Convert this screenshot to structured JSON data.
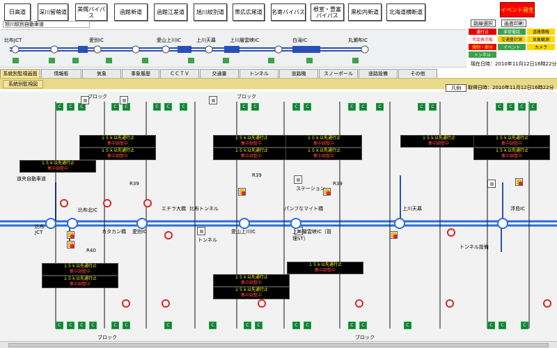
{
  "roads": [
    "日高道",
    "深川留萌道",
    "美幌バイパス",
    "函館新道",
    "函館江差道",
    "旭川紋別道",
    "帯広広尾道",
    "名寄バイパス",
    "根室・豊富バイパス",
    "黒松内新道",
    "北海道横断道"
  ],
  "event_button": "イベント発生",
  "route_label": "旭川紋別自動車道",
  "controls": {
    "route_select": "路線選択",
    "print": "画面印刷"
  },
  "legend": [
    {
      "label": "通行止",
      "bg": "#e60000",
      "fg": "#ffffff"
    },
    {
      "label": "非常電話",
      "bg": "#3aa24a",
      "fg": "#ffffff"
    },
    {
      "label": "道路情報",
      "bg": "#ffd800",
      "fg": "#000000"
    },
    {
      "label": "可変表示板",
      "bg": "#ffffff",
      "fg": "#e00000"
    },
    {
      "label": "交通量計測",
      "bg": "#ffd800",
      "fg": "#000000"
    },
    {
      "label": "気象観測",
      "bg": "#ffd800",
      "fg": "#000000"
    },
    {
      "label": "規制・部分",
      "bg": "#e60000",
      "fg": "#ffff00"
    },
    {
      "label": "イベント",
      "bg": "#3aa24a",
      "fg": "#ffffff"
    },
    {
      "label": "カメラ",
      "bg": "#ffd800",
      "fg": "#000000"
    },
    {
      "label": "トンネル",
      "bg": "#3aa24a",
      "fg": "#ffffff"
    },
    {
      "label": "",
      "bg": "#ffffff",
      "fg": "#000000"
    },
    {
      "label": "",
      "bg": "#ffffff",
      "fg": "#000000"
    }
  ],
  "current_time": "現在日時：2010年11月12日16時22分",
  "tabs": [
    "系統別監視画面",
    "情報板",
    "気象",
    "事象履歴",
    "ＣＣＴＶ",
    "交通量",
    "トンネル",
    "道路機",
    "スノーポール",
    "道路設備",
    "その他"
  ],
  "subtab": "系統別監視図",
  "hanrei": "凡例",
  "acquired": "取得日時：2010年11月12日16時22分",
  "strip_labels": [
    "比布JCT",
    "愛別IC",
    "愛山上川IC",
    "上川天幕",
    "上川層雲峡IC",
    "白滝IC",
    "丸瀬布IC"
  ],
  "map": {
    "expressway": "道央自動車道",
    "jct": "比布JCT",
    "ic": [
      "比布北IC",
      "愛別IC",
      "愛山上川IC",
      "上川層雲峡IC（管理ST）",
      "上川天幕",
      "浮島IC"
    ],
    "msg_line1": "１５ｋ以先通行止",
    "msg_line2": "集中調整中",
    "road_labels": [
      "R39",
      "R40",
      "R39",
      "R39"
    ],
    "misc": [
      "ステーション",
      "パンフなマイト橋",
      "トンネル",
      "比布トンネル",
      "トンネル設備",
      "カタカン橋",
      "エチラ大橋"
    ],
    "blocks": [
      "ブロック",
      "ブロック",
      "ブロック",
      "ブロック"
    ]
  }
}
